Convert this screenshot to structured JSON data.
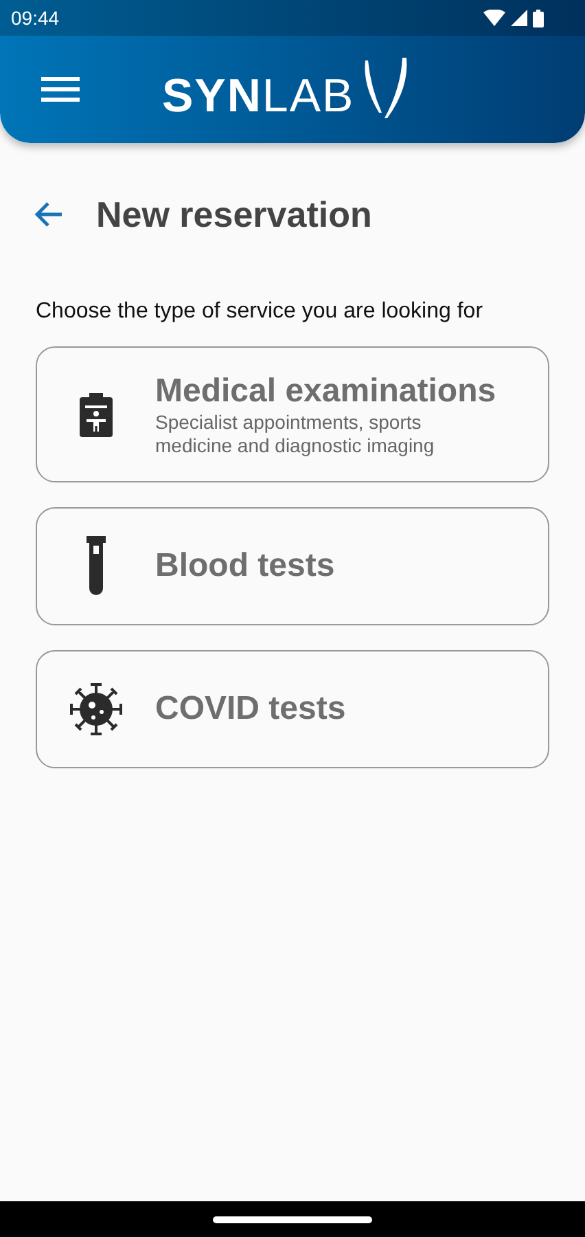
{
  "status_bar": {
    "time": "09:44"
  },
  "header": {
    "logo": "**SYN**LAB"
  },
  "page": {
    "title": "New reservation"
  },
  "prompt": "Choose the type of service you are looking for",
  "services": [
    {
      "kind": "clipboard",
      "title": "Medical examinations",
      "subtitle": "Specialist appointments, sports medicine and diagnostic imaging"
    },
    {
      "kind": "tube",
      "title": "Blood tests"
    },
    {
      "kind": "virus",
      "title": "COVID tests"
    }
  ]
}
